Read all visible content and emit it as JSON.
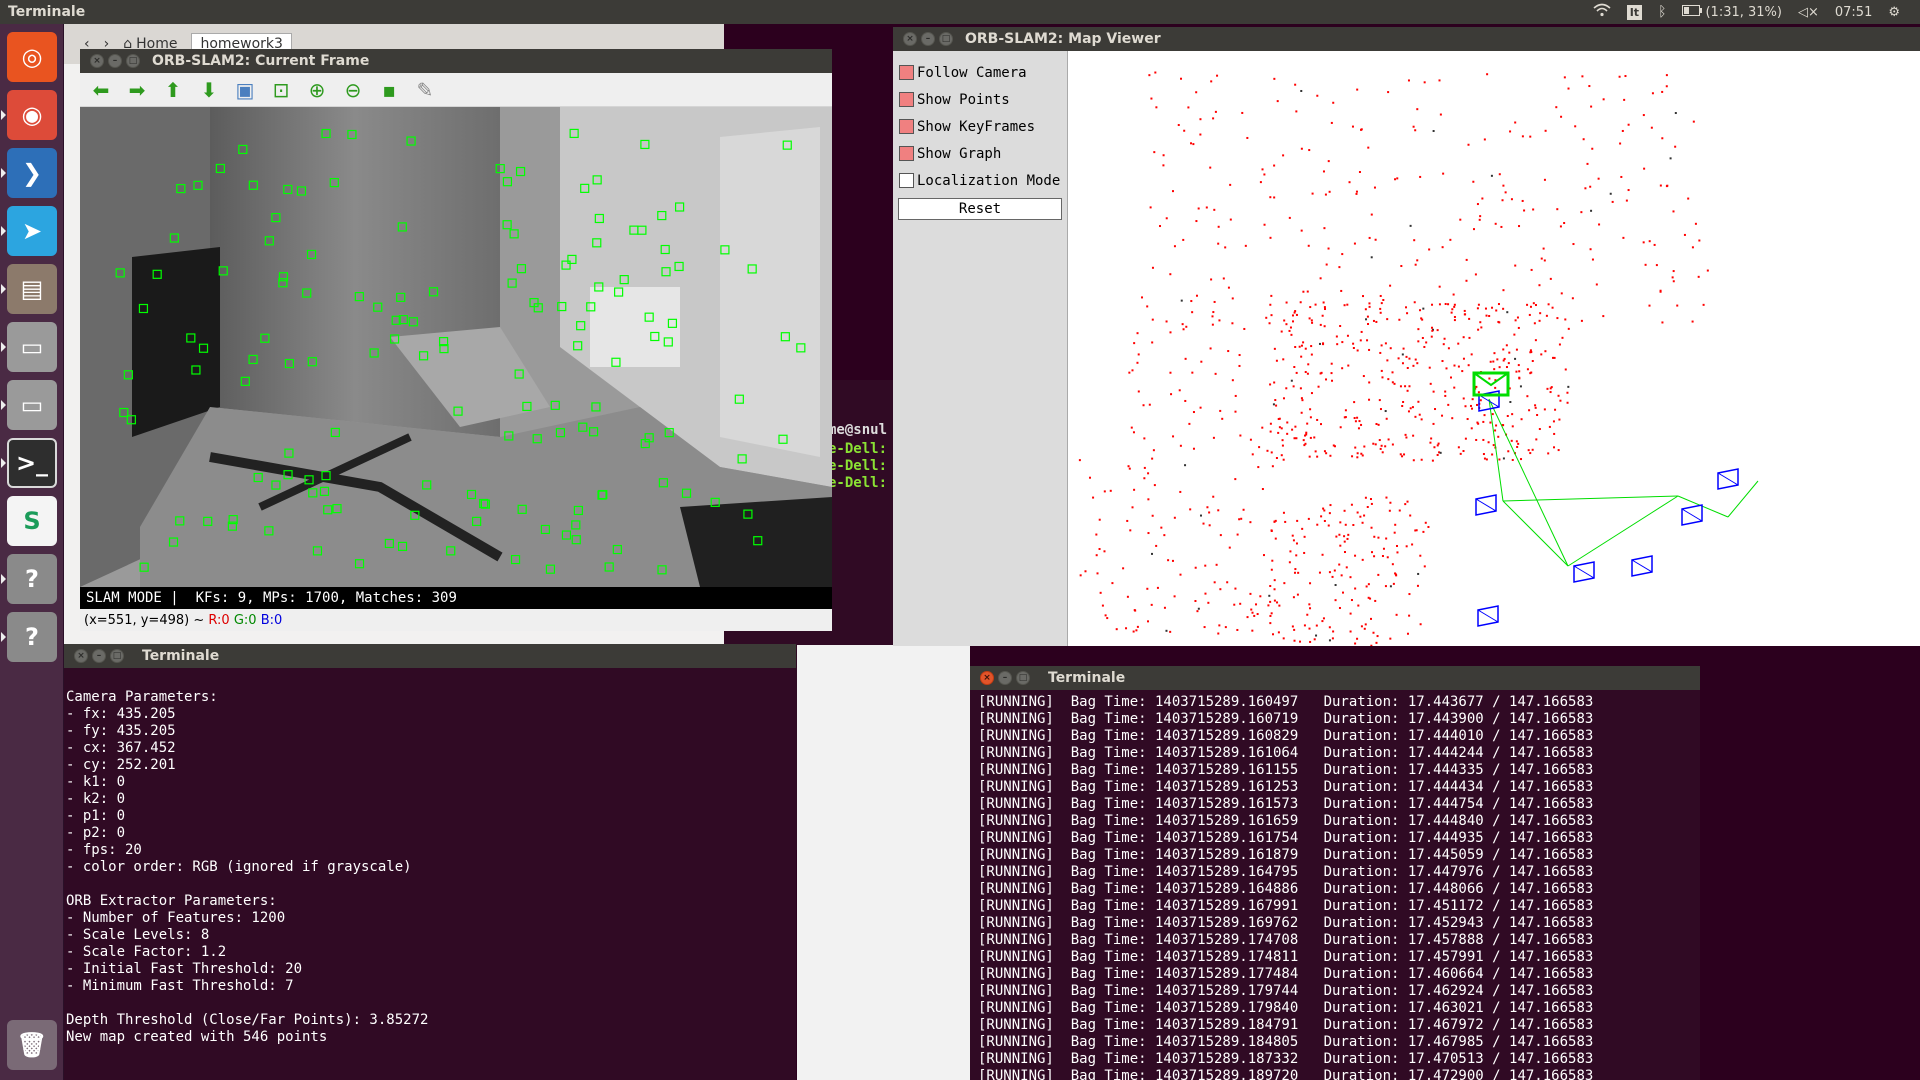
{
  "top_panel": {
    "app_title": "Terminale",
    "keyboard_layout": "It",
    "battery": "(1:31, 31%)",
    "clock": "07:51"
  },
  "launcher": {
    "items": [
      {
        "name": "ubuntu-dash-icon",
        "glyph": "◎",
        "color": "#e95420"
      },
      {
        "name": "chrome-icon",
        "glyph": "◉",
        "color": "#dd4b39"
      },
      {
        "name": "vscode-icon",
        "glyph": "❯",
        "color": "#2d6fb8"
      },
      {
        "name": "telegram-icon",
        "glyph": "➤",
        "color": "#2ca5e0"
      },
      {
        "name": "files-icon",
        "glyph": "▤",
        "color": "#8c7a6b"
      },
      {
        "name": "disk-icon",
        "glyph": "▭",
        "color": "#9a9a9a"
      },
      {
        "name": "disk-icon-2",
        "glyph": "▭",
        "color": "#9a9a9a"
      },
      {
        "name": "terminal-icon",
        "glyph": ">_",
        "color": "#2e2e2e"
      },
      {
        "name": "app-s-icon",
        "glyph": "S",
        "color": "#f4f4f4"
      },
      {
        "name": "unknown-app-icon",
        "glyph": "?",
        "color": "#8a8a8a"
      },
      {
        "name": "unknown-app-icon-2",
        "glyph": "?",
        "color": "#8a8a8a"
      }
    ],
    "trash_glyph": "🗑"
  },
  "background": {
    "nautilus_home": "Home",
    "nautilus_folder": "homework3",
    "term_prompt": "me@snul",
    "term_lines": [
      "e-Dell:",
      "e-Dell:",
      "e-Dell:"
    ]
  },
  "current_frame": {
    "title": "ORB-SLAM2: Current Frame",
    "toolbar": [
      {
        "name": "arrow-left-icon",
        "glyph": "⬅",
        "color": "#2e9a1e"
      },
      {
        "name": "arrow-right-icon",
        "glyph": "➡",
        "color": "#2e9a1e"
      },
      {
        "name": "arrow-up-icon",
        "glyph": "⬆",
        "color": "#2e9a1e"
      },
      {
        "name": "arrow-down-icon",
        "glyph": "⬇",
        "color": "#2e9a1e"
      },
      {
        "name": "image-icon",
        "glyph": "▣",
        "color": "#4b7fbf"
      },
      {
        "name": "zoom-fit-icon",
        "glyph": "⊡",
        "color": "#2e9a1e"
      },
      {
        "name": "zoom-in-icon",
        "glyph": "⊕",
        "color": "#2e9a1e"
      },
      {
        "name": "zoom-out-icon",
        "glyph": "⊖",
        "color": "#2e9a1e"
      },
      {
        "name": "save-icon",
        "glyph": "▪",
        "color": "#2e9a1e"
      },
      {
        "name": "brush-icon",
        "glyph": "✎",
        "color": "#888888"
      }
    ],
    "status_mode": "SLAM MODE |",
    "status_stats": "KFs: 9, MPs: 1700, Matches: 309",
    "coords": "(x=551, y=498) ~",
    "pixel_r": "R:0",
    "pixel_g": "G:0",
    "pixel_b": "B:0"
  },
  "map_viewer": {
    "title": "ORB-SLAM2: Map Viewer",
    "options": [
      {
        "label": "Follow Camera",
        "checked": true
      },
      {
        "label": "Show Points",
        "checked": true
      },
      {
        "label": "Show KeyFrames",
        "checked": true
      },
      {
        "label": "Show Graph",
        "checked": true
      },
      {
        "label": "Localization Mode",
        "checked": false
      }
    ],
    "reset_label": "Reset",
    "colors": {
      "points": "#ff0000",
      "current_camera": "#00dd00",
      "keyframes": "#0000ff",
      "graph": "#00dd00"
    }
  },
  "terminal_left": {
    "title": "Terminale",
    "lines": [
      "",
      "Camera Parameters:",
      "- fx: 435.205",
      "- fy: 435.205",
      "- cx: 367.452",
      "- cy: 252.201",
      "- k1: 0",
      "- k2: 0",
      "- p1: 0",
      "- p2: 0",
      "- fps: 20",
      "- color order: RGB (ignored if grayscale)",
      "",
      "ORB Extractor Parameters:",
      "- Number of Features: 1200",
      "- Scale Levels: 8",
      "- Scale Factor: 1.2",
      "- Initial Fast Threshold: 20",
      "- Minimum Fast Threshold: 7",
      "",
      "Depth Threshold (Close/Far Points): 3.85272",
      "New map created with 546 points"
    ]
  },
  "terminal_right": {
    "title": "Terminale",
    "lines": [
      "[RUNNING]  Bag Time: 1403715289.160497   Duration: 17.443677 / 147.166583",
      "[RUNNING]  Bag Time: 1403715289.160719   Duration: 17.443900 / 147.166583",
      "[RUNNING]  Bag Time: 1403715289.160829   Duration: 17.444010 / 147.166583",
      "[RUNNING]  Bag Time: 1403715289.161064   Duration: 17.444244 / 147.166583",
      "[RUNNING]  Bag Time: 1403715289.161155   Duration: 17.444335 / 147.166583",
      "[RUNNING]  Bag Time: 1403715289.161253   Duration: 17.444434 / 147.166583",
      "[RUNNING]  Bag Time: 1403715289.161573   Duration: 17.444754 / 147.166583",
      "[RUNNING]  Bag Time: 1403715289.161659   Duration: 17.444840 / 147.166583",
      "[RUNNING]  Bag Time: 1403715289.161754   Duration: 17.444935 / 147.166583",
      "[RUNNING]  Bag Time: 1403715289.161879   Duration: 17.445059 / 147.166583",
      "[RUNNING]  Bag Time: 1403715289.164795   Duration: 17.447976 / 147.166583",
      "[RUNNING]  Bag Time: 1403715289.164886   Duration: 17.448066 / 147.166583",
      "[RUNNING]  Bag Time: 1403715289.167991   Duration: 17.451172 / 147.166583",
      "[RUNNING]  Bag Time: 1403715289.169762   Duration: 17.452943 / 147.166583",
      "[RUNNING]  Bag Time: 1403715289.174708   Duration: 17.457888 / 147.166583",
      "[RUNNING]  Bag Time: 1403715289.174811   Duration: 17.457991 / 147.166583",
      "[RUNNING]  Bag Time: 1403715289.177484   Duration: 17.460664 / 147.166583",
      "[RUNNING]  Bag Time: 1403715289.179744   Duration: 17.462924 / 147.166583",
      "[RUNNING]  Bag Time: 1403715289.179840   Duration: 17.463021 / 147.166583",
      "[RUNNING]  Bag Time: 1403715289.184791   Duration: 17.467972 / 147.166583",
      "[RUNNING]  Bag Time: 1403715289.184805   Duration: 17.467985 / 147.166583",
      "[RUNNING]  Bag Time: 1403715289.187332   Duration: 17.470513 / 147.166583",
      "[RUNNING]  Bag Time: 1403715289.189720   Duration: 17.472900 / 147.166583"
    ]
  }
}
